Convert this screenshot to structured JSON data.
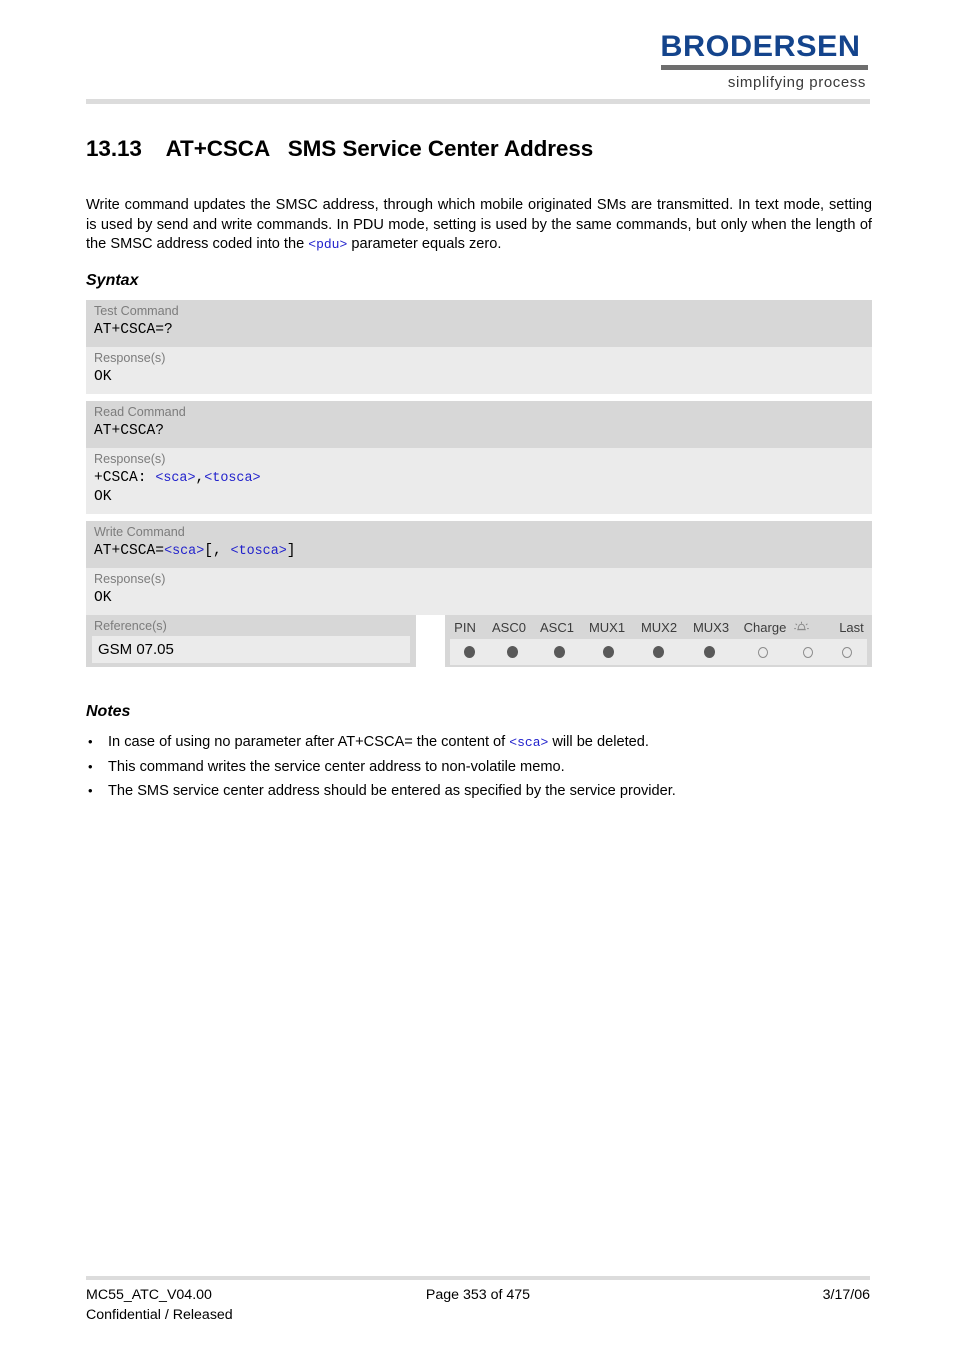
{
  "header": {
    "logo_word": "BRODERSEN",
    "logo_tagline": "simplifying process",
    "logo_color": "#14448c"
  },
  "title": {
    "number": "13.13",
    "command": "AT+CSCA",
    "name": "SMS Service Center Address",
    "full": "13.13    AT+CSCA   SMS Service Center Address"
  },
  "intro": {
    "part1": "Write command updates the SMSC address, through which mobile originated SMs are transmitted. In text mode, setting is used by send and write commands. In PDU mode, setting is used by the same commands, but only when the length of the SMSC address coded into the ",
    "param": "<pdu>",
    "part2": " parameter equals zero."
  },
  "syntax": {
    "heading": "Syntax",
    "blocks": [
      {
        "cmd_label": "Test Command",
        "cmd_text": "AT+CSCA=?",
        "resp_label": "Response(s)",
        "resp_lines": [
          "OK"
        ]
      },
      {
        "cmd_label": "Read Command",
        "cmd_text": "AT+CSCA?",
        "resp_label": "Response(s)",
        "resp_prefix": "+CSCA: ",
        "resp_param1": "<sca>",
        "resp_sep": ",",
        "resp_param2": "<tosca>",
        "resp_lines": [
          "OK"
        ]
      },
      {
        "cmd_label": "Write Command",
        "cmd_prefix": "AT+CSCA=",
        "cmd_param1": "<sca>",
        "cmd_bracket_open": "[,",
        "cmd_space": " ",
        "cmd_param2": "<tosca>",
        "cmd_bracket_close": "]",
        "resp_label": "Response(s)",
        "resp_lines": [
          "OK"
        ]
      }
    ]
  },
  "reference": {
    "label": "Reference(s)",
    "value": "GSM 07.05"
  },
  "capabilities": {
    "columns": [
      "PIN",
      "ASC0",
      "ASC1",
      "MUX1",
      "MUX2",
      "MUX3",
      "Charge",
      "alarm-icon",
      "Last"
    ],
    "states": [
      "filled",
      "filled",
      "filled",
      "filled",
      "filled",
      "filled",
      "hollow",
      "hollow",
      "hollow"
    ],
    "filled_color": "#595959",
    "hollow_color": "#8c8c8c"
  },
  "notes": {
    "heading": "Notes",
    "bullet": "•",
    "items": [
      {
        "part1": "In case of using no parameter after AT+CSCA= the content of ",
        "param": "<sca>",
        "part2": " will be deleted."
      },
      {
        "part1": "This command writes the service center address to non-volatile memo.",
        "param": "",
        "part2": ""
      },
      {
        "part1": "The SMS service center address should be entered as specified by the service provider.",
        "param": "",
        "part2": ""
      }
    ]
  },
  "footer": {
    "doc_id": "MC55_ATC_V04.00",
    "classification": "Confidential / Released",
    "page": "Page 353 of 475",
    "date": "3/17/06"
  }
}
